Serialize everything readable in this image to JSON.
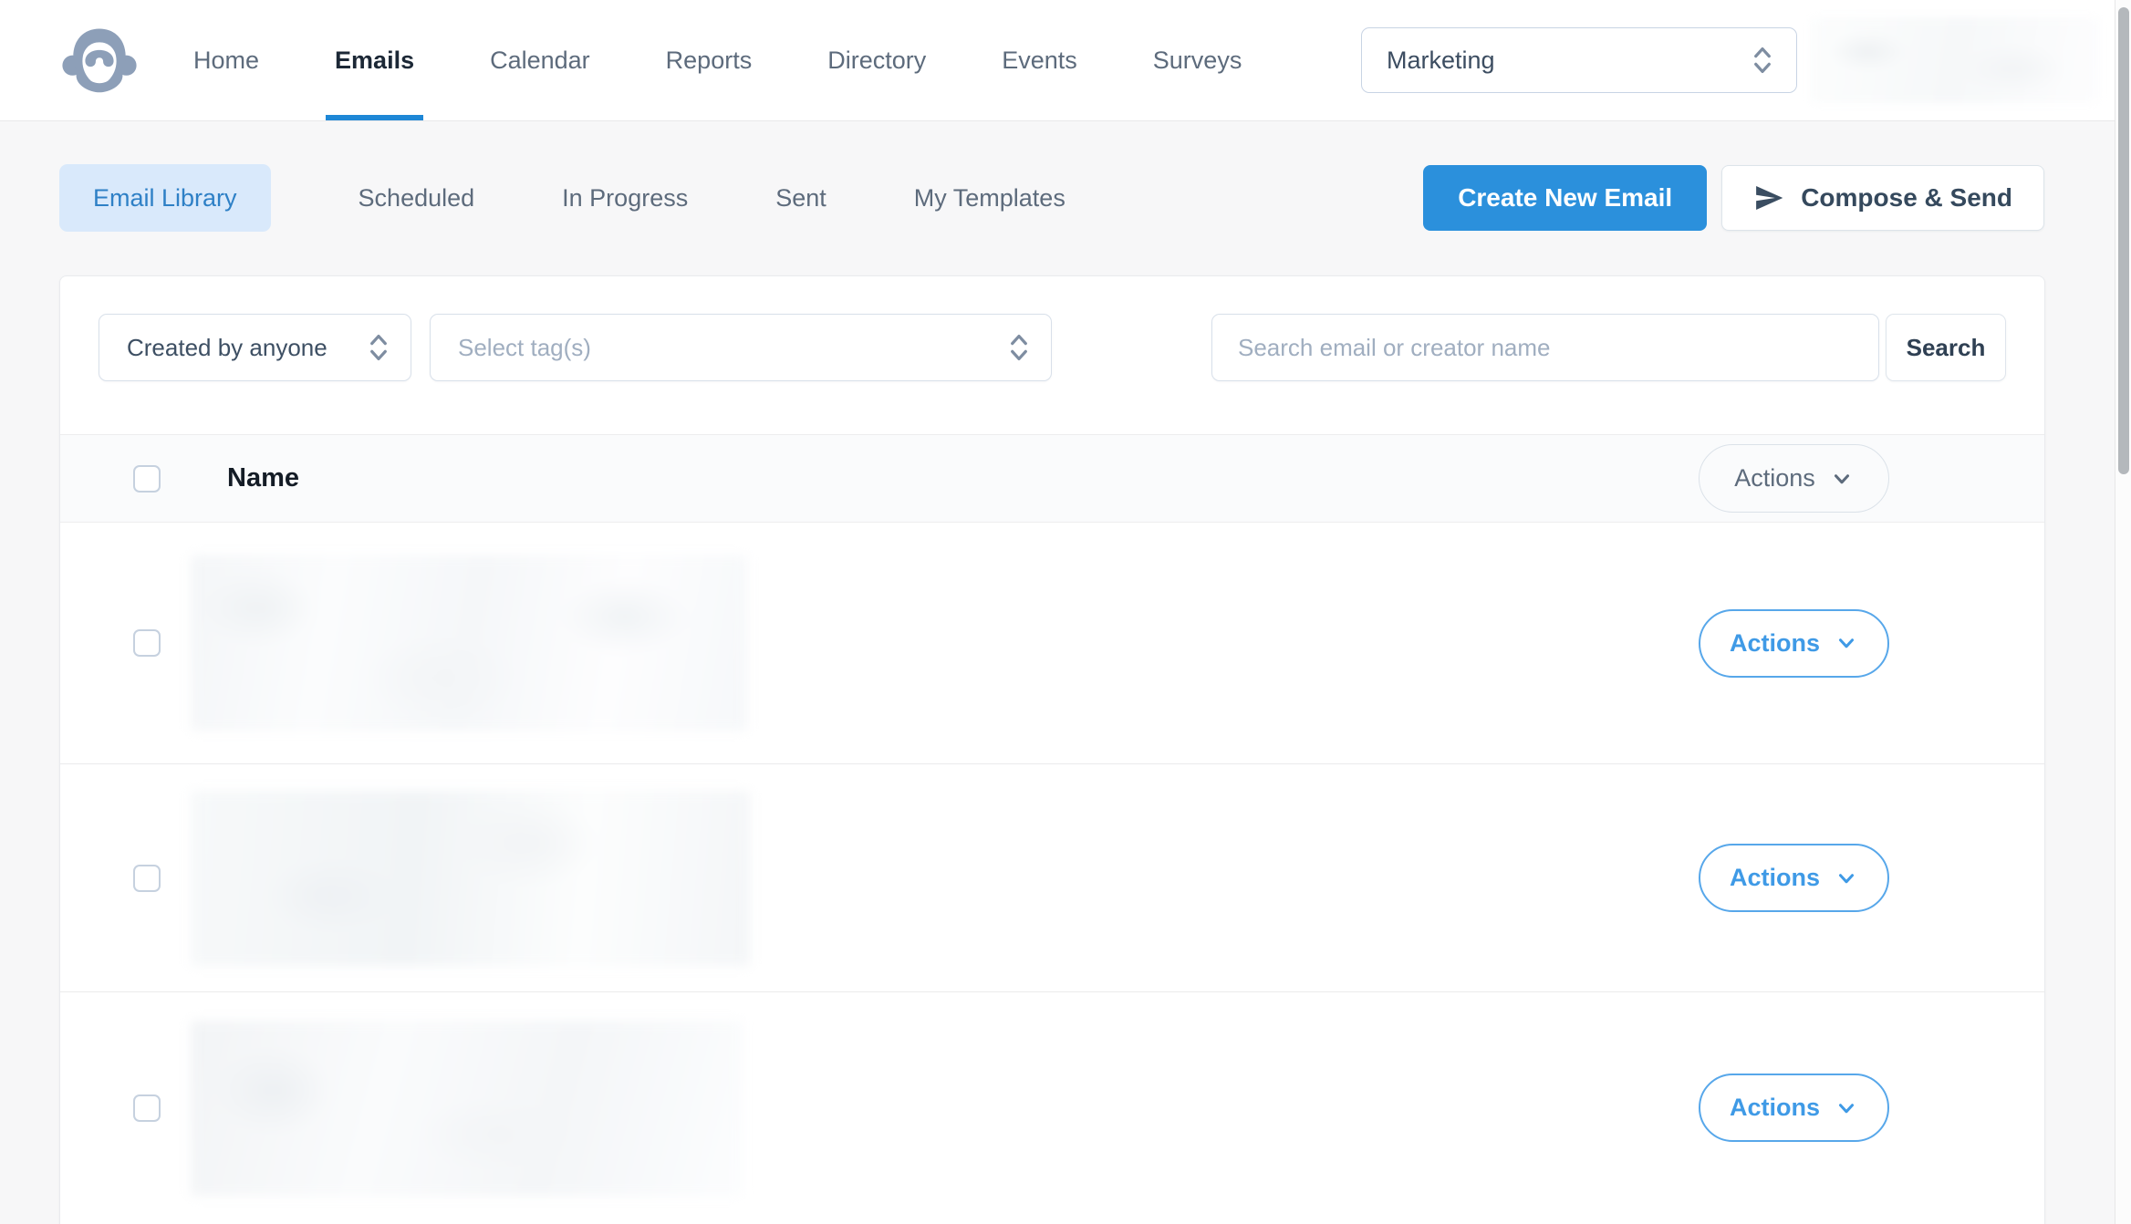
{
  "brand": {
    "logo_icon": "monkey-logo",
    "accent_color": "#2b90dc",
    "active_underline_color": "#1e87d6",
    "active_tab_bg": "#d9e9fb",
    "actions_blue": "#3f9ae6"
  },
  "nav": {
    "items": [
      {
        "label": "Home",
        "active": false
      },
      {
        "label": "Emails",
        "active": true
      },
      {
        "label": "Calendar",
        "active": false
      },
      {
        "label": "Reports",
        "active": false
      },
      {
        "label": "Directory",
        "active": false
      },
      {
        "label": "Events",
        "active": false
      },
      {
        "label": "Surveys",
        "active": false
      }
    ],
    "team_selector": {
      "value": "Marketing",
      "icon": "stepper-up-down"
    },
    "user_area": {
      "redacted": true
    }
  },
  "tabs": {
    "items": [
      {
        "label": "Email Library",
        "active": true
      },
      {
        "label": "Scheduled",
        "active": false
      },
      {
        "label": "In Progress",
        "active": false
      },
      {
        "label": "Sent",
        "active": false
      },
      {
        "label": "My Templates",
        "active": false
      }
    ]
  },
  "actions_bar": {
    "create_new_email_label": "Create New Email",
    "compose_and_send_label": "Compose & Send",
    "compose_icon": "send-paper-plane"
  },
  "filters": {
    "created_by_value": "Created by anyone",
    "tags_placeholder": "Select tag(s)",
    "search_placeholder": "Search email or creator name",
    "search_button_label": "Search"
  },
  "table": {
    "header": {
      "name_column_label": "Name",
      "actions_label": "Actions",
      "select_all_checkbox_checked": false
    },
    "rows": [
      {
        "actions_label": "Actions",
        "checkbox_checked": false,
        "content_redacted": true
      },
      {
        "actions_label": "Actions",
        "checkbox_checked": false,
        "content_redacted": true
      },
      {
        "actions_label": "Actions",
        "checkbox_checked": false,
        "content_redacted": true
      }
    ]
  }
}
